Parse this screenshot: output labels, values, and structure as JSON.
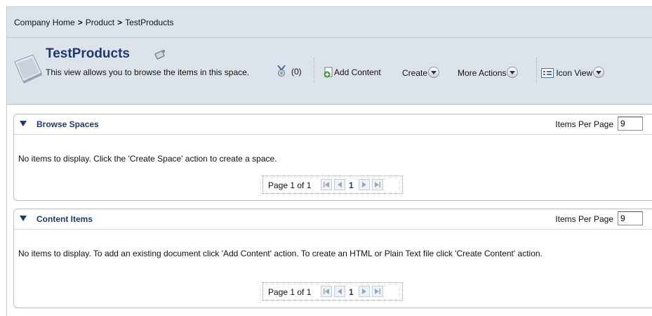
{
  "breadcrumb": [
    "Company Home",
    "Product",
    "TestProducts"
  ],
  "breadcrumb_separator": ">",
  "header": {
    "title": "TestProducts",
    "description": "This view allows you to browse the items in this space.",
    "rules_count": "(0)",
    "actions": {
      "add_content": "Add Content",
      "create": "Create",
      "more_actions": "More Actions",
      "view": "Icon View"
    },
    "icons": {
      "space": "space-folder-icon",
      "title": "rss-feed-icon",
      "rules": "rules-medal-icon",
      "add_content": "add-content-icon",
      "view": "icon-view-icon"
    }
  },
  "panels": [
    {
      "title": "Browse Spaces",
      "items_per_page_label": "Items Per Page",
      "items_per_page": "9",
      "message": "No items to display. Click the 'Create Space' action to create a space.",
      "pager": {
        "label": "Page 1 of 1",
        "current": "1"
      }
    },
    {
      "title": "Content Items",
      "items_per_page_label": "Items Per Page",
      "items_per_page": "9",
      "message": "No items to display. To add an existing document click 'Add Content' action. To create an HTML or Plain Text file click 'Create Content' action.",
      "pager": {
        "label": "Page 1 of 1",
        "current": "1"
      }
    }
  ],
  "colors": {
    "header_bg": "#dde3ea",
    "title": "#1d3a6b",
    "panel_border": "#b9c0c8"
  }
}
